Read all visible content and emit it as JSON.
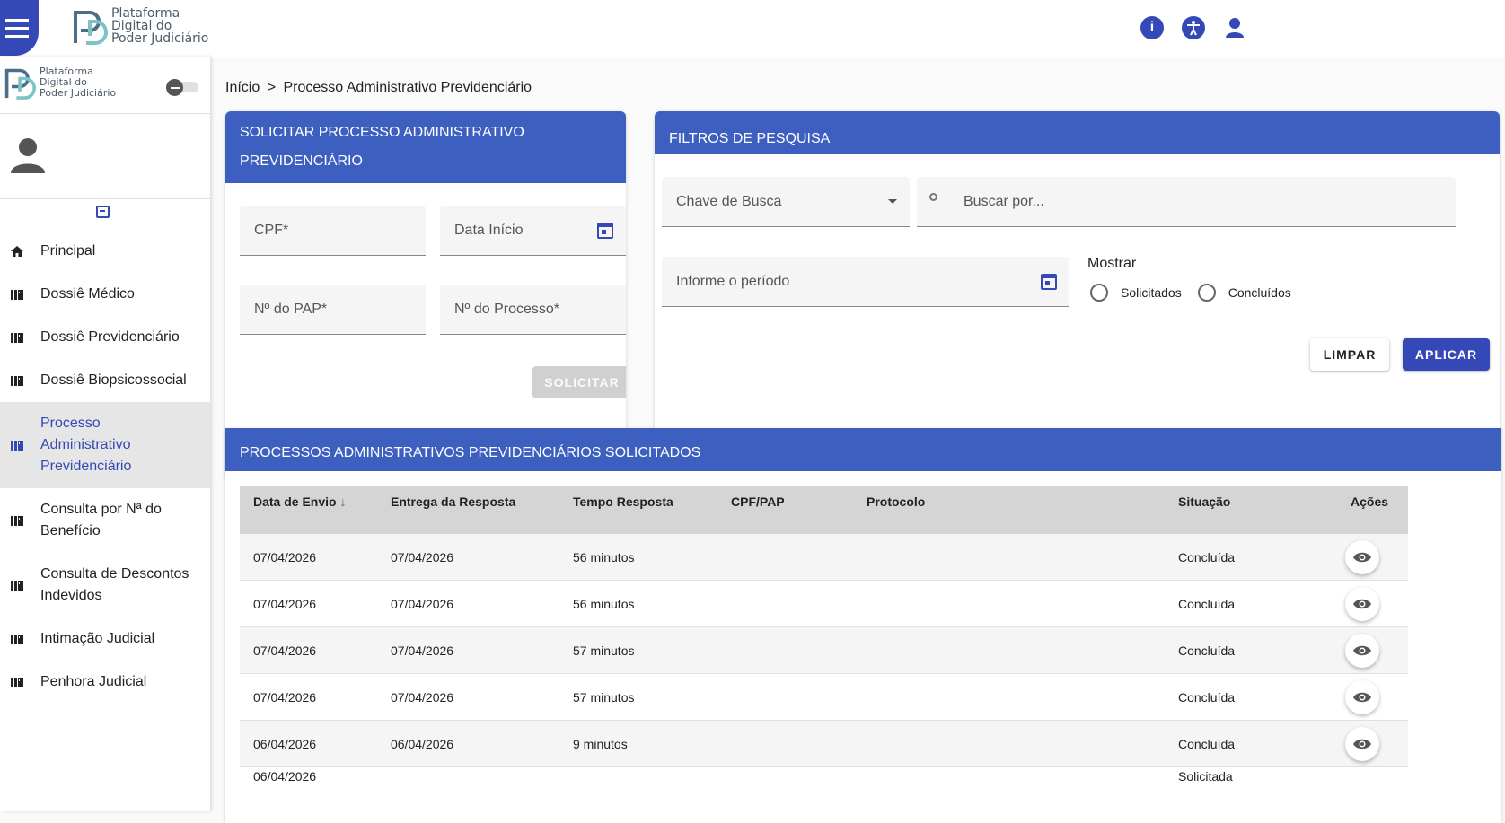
{
  "header": {
    "logo_text": [
      "Plataforma",
      "Digital do",
      "Poder Judiciário"
    ],
    "icons": [
      "info-icon",
      "accessibility-icon",
      "user-icon"
    ]
  },
  "sidebar": {
    "logo_text": [
      "Plataforma",
      "Digital do",
      "Poder Judiciário"
    ],
    "items": [
      {
        "label": "Principal",
        "icon": "home-icon"
      },
      {
        "label": "Dossiê Médico",
        "icon": "library-icon"
      },
      {
        "label": "Dossiê Previdenciário",
        "icon": "library-icon"
      },
      {
        "label": "Dossiê Biopsicossocial",
        "icon": "library-icon"
      },
      {
        "label": "Processo Administrativo Previdenciário",
        "icon": "library-icon",
        "active": true
      },
      {
        "label": "Consulta por Nª do Benefício",
        "icon": "library-icon"
      },
      {
        "label": "Consulta de Descontos Indevidos",
        "icon": "library-icon"
      },
      {
        "label": "Intimação Judicial",
        "icon": "library-icon"
      },
      {
        "label": "Penhora Judicial",
        "icon": "library-icon"
      }
    ]
  },
  "breadcrumb": {
    "home": "Início",
    "separator": ">",
    "current": "Processo Administrativo Previdenciário"
  },
  "solicitar": {
    "title": "SOLICITAR PROCESSO ADMINISTRATIVO PREVIDENCIÁRIO",
    "cpf_placeholder": "CPF*",
    "data_inicio_placeholder": "Data Início",
    "pap_placeholder": "Nº do PAP*",
    "processo_placeholder": "Nº do Processo*",
    "submit_label": "SOLICITAR"
  },
  "filtros": {
    "title": "FILTROS DE PESQUISA",
    "chave_label": "Chave de Busca",
    "buscar_placeholder": "Buscar por...",
    "periodo_placeholder": "Informe o período",
    "mostrar_label": "Mostrar",
    "radio_solicitados": "Solicitados",
    "radio_concluidos": "Concluídos",
    "limpar_label": "LIMPAR",
    "aplicar_label": "APLICAR"
  },
  "tabela": {
    "title": "PROCESSOS ADMINISTRATIVOS PREVIDENCIÁRIOS SOLICITADOS",
    "columns": [
      "Data de Envio",
      "Entrega da Resposta",
      "Tempo Resposta",
      "CPF/PAP",
      "Protocolo",
      "Situação",
      "Ações"
    ],
    "rows": [
      {
        "envio": "07/04/2026",
        "entrega": "07/04/2026",
        "tempo": "56 minutos",
        "cpf": "",
        "protocolo": "",
        "situacao": "Concluída"
      },
      {
        "envio": "07/04/2026",
        "entrega": "07/04/2026",
        "tempo": "56 minutos",
        "cpf": "",
        "protocolo": "",
        "situacao": "Concluída"
      },
      {
        "envio": "07/04/2026",
        "entrega": "07/04/2026",
        "tempo": "57 minutos",
        "cpf": "",
        "protocolo": "",
        "situacao": "Concluída"
      },
      {
        "envio": "07/04/2026",
        "entrega": "07/04/2026",
        "tempo": "57 minutos",
        "cpf": "",
        "protocolo": "",
        "situacao": "Concluída"
      },
      {
        "envio": "06/04/2026",
        "entrega": "06/04/2026",
        "tempo": "9 minutos",
        "cpf": "",
        "protocolo": "",
        "situacao": "Concluída"
      },
      {
        "envio": "06/04/2026",
        "entrega": "",
        "tempo": "",
        "cpf": "",
        "protocolo": "",
        "situacao": "Solicitada"
      }
    ]
  },
  "colors": {
    "primary": "#3449b6",
    "card_header": "#3d5fc0",
    "table_header": "#d5d5d5",
    "active_menu_bg": "#e6e6e6"
  }
}
